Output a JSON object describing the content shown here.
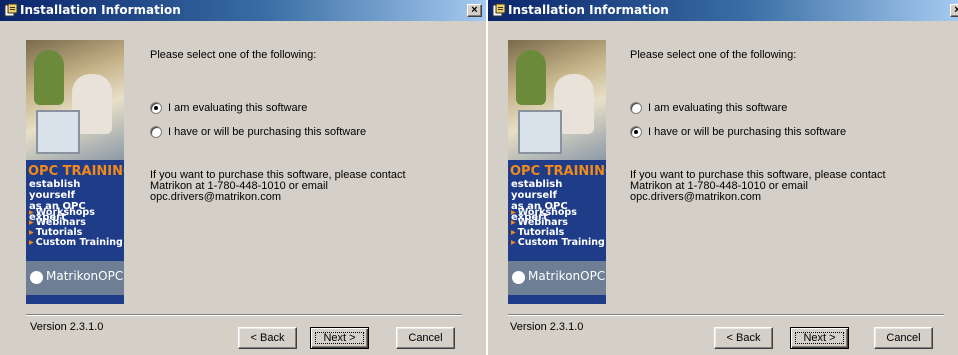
{
  "dialogs": [
    {
      "title": "Installation Information",
      "prompt": "Please select one of the following:",
      "options": [
        {
          "label": "I am evaluating this software",
          "selected": true
        },
        {
          "label": "I have or will be purchasing this software",
          "selected": false
        }
      ],
      "info": [
        "If you want to purchase this software, please contact",
        "Matrikon at 1-780-448-1010 or email",
        "opc.drivers@matrikon.com"
      ],
      "version": "Version 2.3.1.0",
      "buttons": {
        "back": "< Back",
        "next": "Next >",
        "cancel": "Cancel"
      },
      "close_glyph": "×"
    },
    {
      "title": "Installation Information",
      "prompt": "Please select one of the following:",
      "options": [
        {
          "label": "I am evaluating this software",
          "selected": false
        },
        {
          "label": "I have or will be purchasing this software",
          "selected": true
        }
      ],
      "info": [
        "If you want to purchase this software, please contact",
        "Matrikon at 1-780-448-1010 or email",
        "opc.drivers@matrikon.com"
      ],
      "version": "Version 2.3.1.0",
      "buttons": {
        "back": "< Back",
        "next": "Next >",
        "cancel": "Cancel"
      },
      "close_glyph": "×"
    }
  ],
  "banner": {
    "heading": "OPC TRAINING",
    "subtitle": [
      "establish yourself",
      "as an OPC expert"
    ],
    "items": [
      "Workshops",
      "Webinars",
      "Tutorials",
      "Custom Training"
    ],
    "logo": "MatrikonOPC"
  },
  "colors": {
    "titlebar_start": "#0a246a",
    "titlebar_end": "#a6caf0",
    "dialog_face": "#d4d0c8",
    "banner_blue": "#1f3c88",
    "banner_orange": "#f28a1b"
  }
}
